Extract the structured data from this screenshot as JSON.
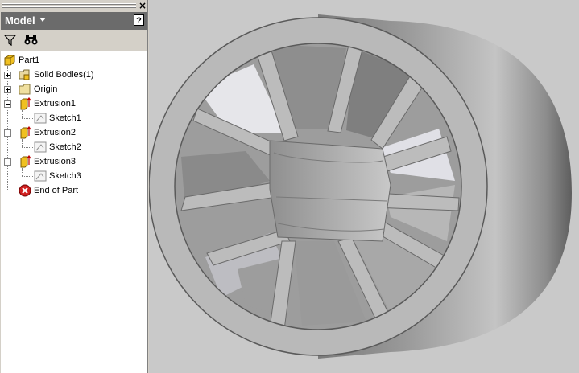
{
  "panel": {
    "title": "Model",
    "help_label": "?",
    "close_label": "×"
  },
  "toolbar": {
    "filter_icon": "filter-icon",
    "find_icon": "binoculars-icon"
  },
  "tree": {
    "root": "Part1",
    "items": [
      {
        "label": "Solid Bodies(1)",
        "icon": "solid-bodies-icon"
      },
      {
        "label": "Origin",
        "icon": "folder-icon"
      },
      {
        "label": "Extrusion1",
        "icon": "extrusion-icon"
      },
      {
        "label": "Sketch1",
        "icon": "sketch-icon"
      },
      {
        "label": "Extrusion2",
        "icon": "extrusion-icon"
      },
      {
        "label": "Sketch2",
        "icon": "sketch-icon"
      },
      {
        "label": "Extrusion3",
        "icon": "extrusion-icon"
      },
      {
        "label": "Sketch3",
        "icon": "sketch-icon"
      },
      {
        "label": "End of Part",
        "icon": "end-of-part-icon"
      }
    ]
  },
  "viewport": {
    "background": "#c9c9c9",
    "part_color": "#b8b8b8"
  }
}
